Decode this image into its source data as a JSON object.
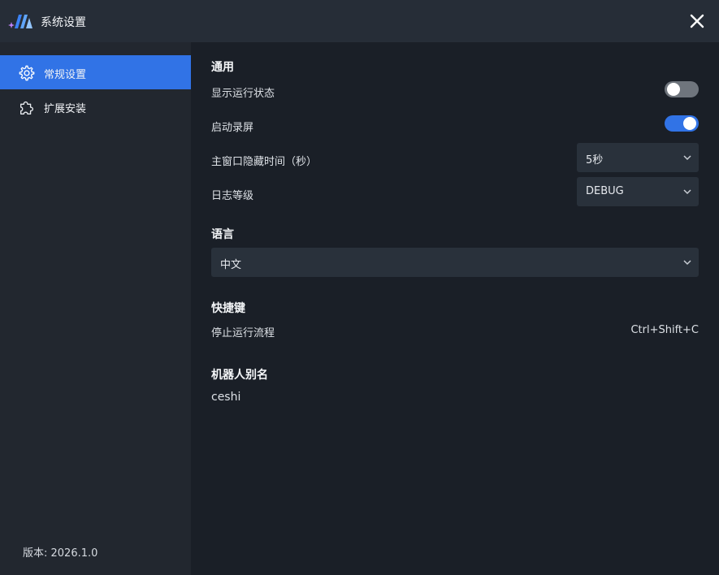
{
  "window": {
    "title": "系统设置"
  },
  "sidebar": {
    "items": [
      {
        "label": "常规设置",
        "active": true
      },
      {
        "label": "扩展安装",
        "active": false
      }
    ],
    "version": "版本: 2026.1.0"
  },
  "general": {
    "title": "通用",
    "show_status": {
      "label": "显示运行状态",
      "enabled": false
    },
    "screen_record": {
      "label": "启动录屏",
      "enabled": true
    },
    "hide_time": {
      "label": "主窗口隐藏时间（秒）",
      "value": "5秒"
    },
    "log_level": {
      "label": "日志等级",
      "value": "DEBUG"
    }
  },
  "language": {
    "title": "语言",
    "value": "中文"
  },
  "hotkeys": {
    "title": "快捷键",
    "stop_flow": {
      "label": "停止运行流程",
      "value": "Ctrl+Shift+C"
    }
  },
  "robot": {
    "title": "机器人别名",
    "alias": "ceshi"
  },
  "colors": {
    "accent": "#3173e6",
    "titlebar": "#262d37",
    "sidebar": "#22272f",
    "background": "#1a1f27"
  }
}
